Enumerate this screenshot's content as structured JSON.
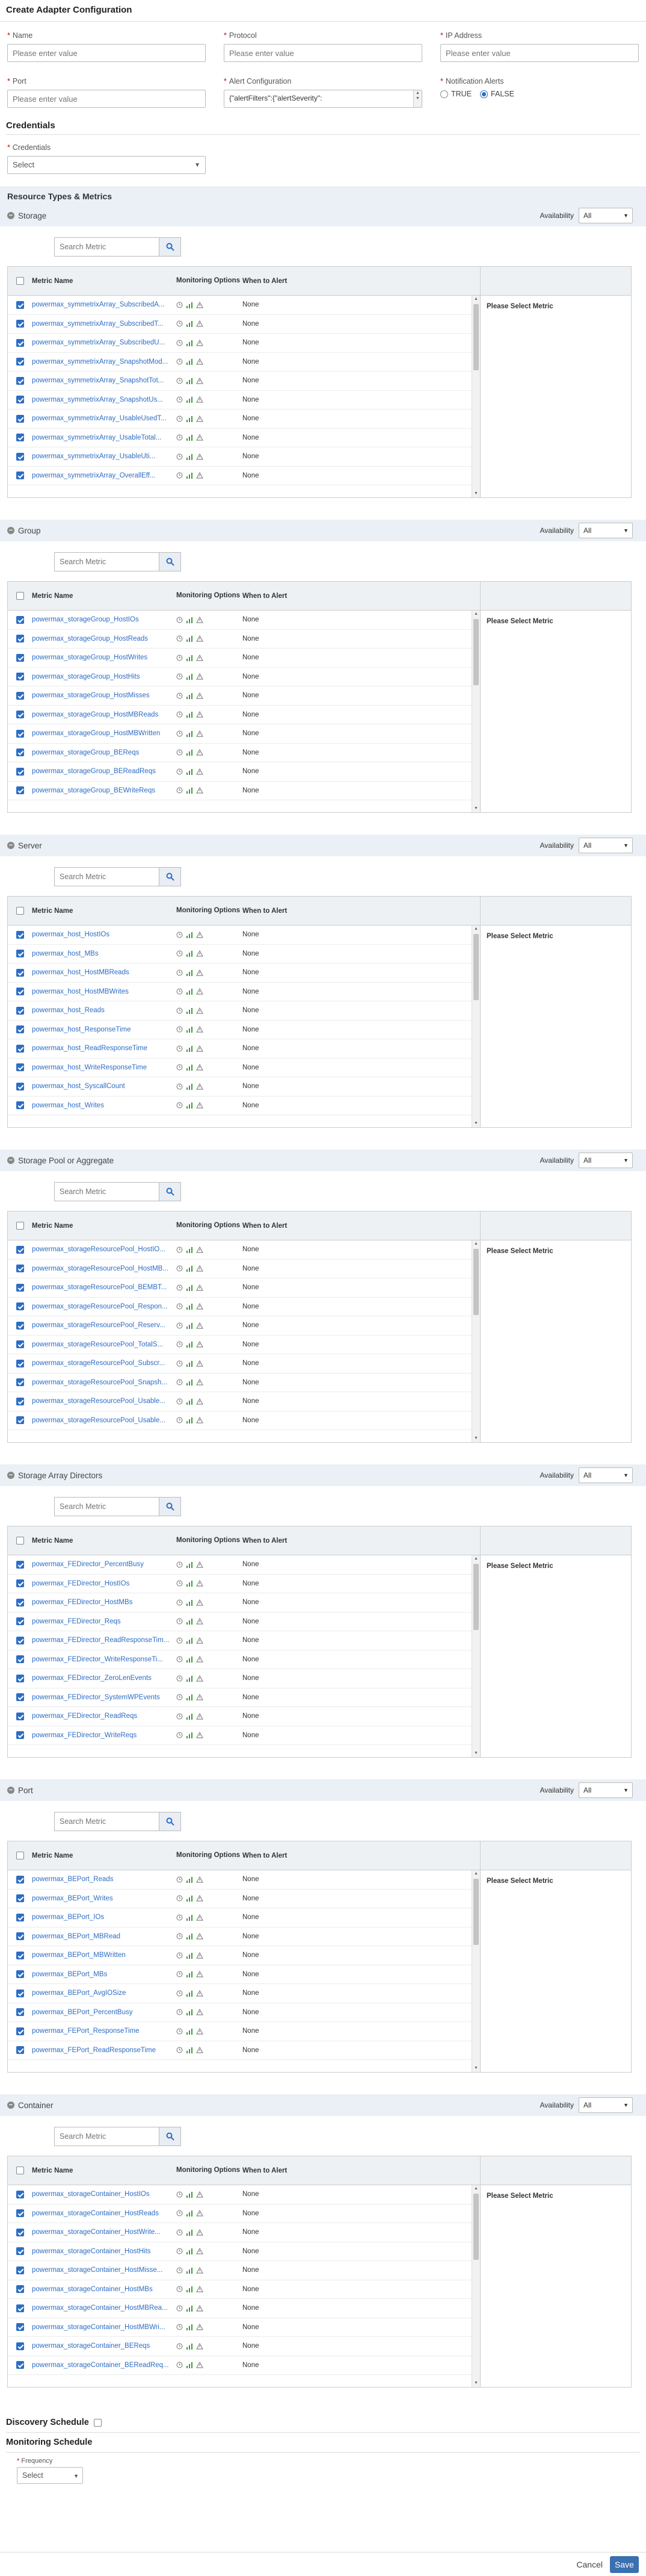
{
  "page": {
    "title": "Create Adapter Configuration"
  },
  "form": {
    "name": {
      "label": "Name",
      "placeholder": "Please enter value"
    },
    "protocol": {
      "label": "Protocol",
      "placeholder": "Please enter value"
    },
    "ip": {
      "label": "IP Address",
      "placeholder": "Please enter value"
    },
    "port": {
      "label": "Port",
      "placeholder": "Please enter value"
    },
    "alert": {
      "label": "Alert Configuration",
      "value": "{\"alertFilters\":{\"alertSeverity\":"
    },
    "notification": {
      "label": "Notification Alerts",
      "true_label": "TRUE",
      "false_label": "FALSE",
      "selected": "FALSE"
    }
  },
  "credentials": {
    "section_title": "Credentials",
    "label": "Credentials",
    "value": "Select"
  },
  "resource_section_title": "Resource Types & Metrics",
  "table_headers": {
    "name": "Metric Name",
    "options": "Monitoring Options",
    "when": "When to Alert"
  },
  "availability_label": "Availability",
  "availability_value": "All",
  "search_placeholder": "Search Metric",
  "select_prompt": "Please Select Metric",
  "resources": [
    {
      "name": "Storage",
      "rows": [
        {
          "metric": "powermax_symmetrixArray_SubscribedA...",
          "when": "None"
        },
        {
          "metric": "powermax_symmetrixArray_SubscribedT...",
          "when": "None"
        },
        {
          "metric": "powermax_symmetrixArray_SubscribedU...",
          "when": "None"
        },
        {
          "metric": "powermax_symmetrixArray_SnapshotMod...",
          "when": "None"
        },
        {
          "metric": "powermax_symmetrixArray_SnapshotTot...",
          "when": "None"
        },
        {
          "metric": "powermax_symmetrixArray_SnapshotUs...",
          "when": "None"
        },
        {
          "metric": "powermax_symmetrixArray_UsableUsedT...",
          "when": "None"
        },
        {
          "metric": "powermax_symmetrixArray_UsableTotal...",
          "when": "None"
        },
        {
          "metric": "powermax_symmetrixArray_UsableUti...",
          "when": "None"
        },
        {
          "metric": "powermax_symmetrixArray_OverallEff...",
          "when": "None"
        }
      ]
    },
    {
      "name": "Group",
      "rows": [
        {
          "metric": "powermax_storageGroup_HostIOs",
          "when": "None"
        },
        {
          "metric": "powermax_storageGroup_HostReads",
          "when": "None"
        },
        {
          "metric": "powermax_storageGroup_HostWrites",
          "when": "None"
        },
        {
          "metric": "powermax_storageGroup_HostHits",
          "when": "None"
        },
        {
          "metric": "powermax_storageGroup_HostMisses",
          "when": "None"
        },
        {
          "metric": "powermax_storageGroup_HostMBReads",
          "when": "None"
        },
        {
          "metric": "powermax_storageGroup_HostMBWritten",
          "when": "None"
        },
        {
          "metric": "powermax_storageGroup_BEReqs",
          "when": "None"
        },
        {
          "metric": "powermax_storageGroup_BEReadReqs",
          "when": "None"
        },
        {
          "metric": "powermax_storageGroup_BEWriteReqs",
          "when": "None"
        }
      ]
    },
    {
      "name": "Server",
      "rows": [
        {
          "metric": "powermax_host_HostIOs",
          "when": "None"
        },
        {
          "metric": "powermax_host_MBs",
          "when": "None"
        },
        {
          "metric": "powermax_host_HostMBReads",
          "when": "None"
        },
        {
          "metric": "powermax_host_HostMBWrites",
          "when": "None"
        },
        {
          "metric": "powermax_host_Reads",
          "when": "None"
        },
        {
          "metric": "powermax_host_ResponseTime",
          "when": "None"
        },
        {
          "metric": "powermax_host_ReadResponseTime",
          "when": "None"
        },
        {
          "metric": "powermax_host_WriteResponseTime",
          "when": "None"
        },
        {
          "metric": "powermax_host_SyscallCount",
          "when": "None"
        },
        {
          "metric": "powermax_host_Writes",
          "when": "None"
        }
      ]
    },
    {
      "name": "Storage Pool or Aggregate",
      "rows": [
        {
          "metric": "powermax_storageResourcePool_HostIO...",
          "when": "None"
        },
        {
          "metric": "powermax_storageResourcePool_HostMB...",
          "when": "None"
        },
        {
          "metric": "powermax_storageResourcePool_BEMBT...",
          "when": "None"
        },
        {
          "metric": "powermax_storageResourcePool_Respon...",
          "when": "None"
        },
        {
          "metric": "powermax_storageResourcePool_Reserv...",
          "when": "None"
        },
        {
          "metric": "powermax_storageResourcePool_TotalS...",
          "when": "None"
        },
        {
          "metric": "powermax_storageResourcePool_Subscr...",
          "when": "None"
        },
        {
          "metric": "powermax_storageResourcePool_Snapsh...",
          "when": "None"
        },
        {
          "metric": "powermax_storageResourcePool_Usable...",
          "when": "None"
        },
        {
          "metric": "powermax_storageResourcePool_Usable...",
          "when": "None"
        }
      ]
    },
    {
      "name": "Storage Array Directors",
      "rows": [
        {
          "metric": "powermax_FEDirector_PercentBusy",
          "when": "None"
        },
        {
          "metric": "powermax_FEDirector_HostIOs",
          "when": "None"
        },
        {
          "metric": "powermax_FEDirector_HostMBs",
          "when": "None"
        },
        {
          "metric": "powermax_FEDirector_Reqs",
          "when": "None"
        },
        {
          "metric": "powermax_FEDirector_ReadResponseTim...",
          "when": "None"
        },
        {
          "metric": "powermax_FEDirector_WriteResponseTi...",
          "when": "None"
        },
        {
          "metric": "powermax_FEDirector_ZeroLenEvents",
          "when": "None"
        },
        {
          "metric": "powermax_FEDirector_SystemWPEvents",
          "when": "None"
        },
        {
          "metric": "powermax_FEDirector_ReadReqs",
          "when": "None"
        },
        {
          "metric": "powermax_FEDirector_WriteReqs",
          "when": "None"
        }
      ]
    },
    {
      "name": "Port",
      "rows": [
        {
          "metric": "powermax_BEPort_Reads",
          "when": "None"
        },
        {
          "metric": "powermax_BEPort_Writes",
          "when": "None"
        },
        {
          "metric": "powermax_BEPort_IOs",
          "when": "None"
        },
        {
          "metric": "powermax_BEPort_MBRead",
          "when": "None"
        },
        {
          "metric": "powermax_BEPort_MBWritten",
          "when": "None"
        },
        {
          "metric": "powermax_BEPort_MBs",
          "when": "None"
        },
        {
          "metric": "powermax_BEPort_AvgIOSize",
          "when": "None"
        },
        {
          "metric": "powermax_BEPort_PercentBusy",
          "when": "None"
        },
        {
          "metric": "powermax_FEPort_ResponseTime",
          "when": "None"
        },
        {
          "metric": "powermax_FEPort_ReadResponseTime",
          "when": "None"
        }
      ]
    },
    {
      "name": "Container",
      "rows": [
        {
          "metric": "powermax_storageContainer_HostIOs",
          "when": "None"
        },
        {
          "metric": "powermax_storageContainer_HostReads",
          "when": "None"
        },
        {
          "metric": "powermax_storageContainer_HostWrite...",
          "when": "None"
        },
        {
          "metric": "powermax_storageContainer_HostHits",
          "when": "None"
        },
        {
          "metric": "powermax_storageContainer_HostMisse...",
          "when": "None"
        },
        {
          "metric": "powermax_storageContainer_HostMBs",
          "when": "None"
        },
        {
          "metric": "powermax_storageContainer_HostMBRea...",
          "when": "None"
        },
        {
          "metric": "powermax_storageContainer_HostMBWri...",
          "when": "None"
        },
        {
          "metric": "powermax_storageContainer_BEReqs",
          "when": "None"
        },
        {
          "metric": "powermax_storageContainer_BEReadReq...",
          "when": "None"
        }
      ]
    }
  ],
  "discovery": {
    "title": "Discovery Schedule"
  },
  "monitoring": {
    "title": "Monitoring Schedule",
    "freq_label": "Frequency",
    "freq_value": "Select"
  },
  "actions": {
    "cancel": "Cancel",
    "save": "Save"
  },
  "colors": {
    "accent": "#2d6dc4",
    "save_bg": "#3a6fb0",
    "band": "#eaf0f5"
  }
}
